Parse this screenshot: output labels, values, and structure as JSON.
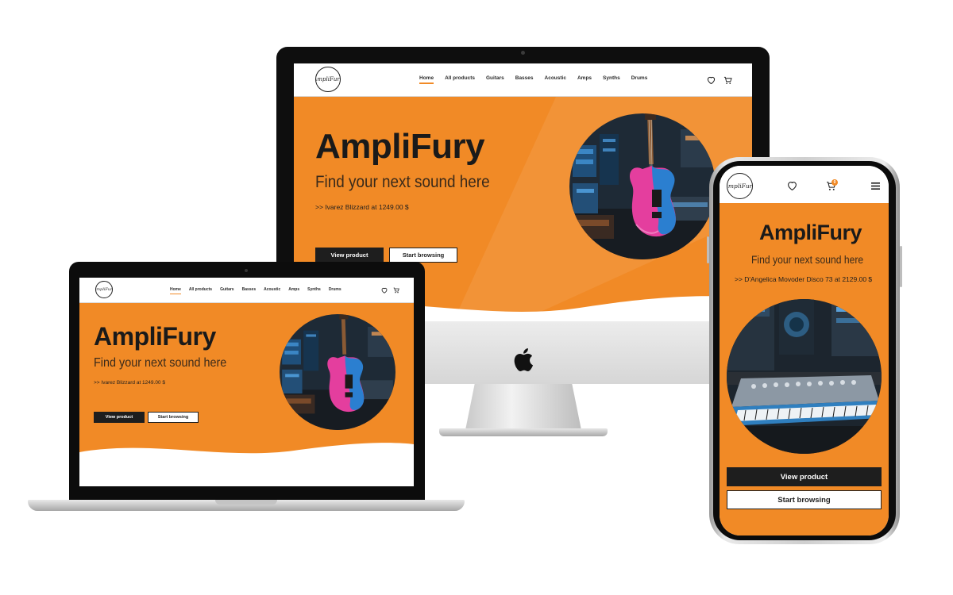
{
  "site": {
    "logo_text": "AmpliFury",
    "nav": [
      "Home",
      "All products",
      "Guitars",
      "Basses",
      "Acoustic",
      "Amps",
      "Synths",
      "Drums"
    ],
    "active_nav": "Home",
    "hero_title": "AmpliFury",
    "hero_subtitle": "Find your next sound here",
    "view_button": "View product",
    "browse_button": "Start browsing"
  },
  "desktop": {
    "promo": ">> Ivarez Blizzard at 1249.00 $",
    "image": "pink-blue-bass-guitar-photo"
  },
  "laptop": {
    "promo": ">> Ivarez Blizzard at 1249.00 $",
    "image": "pink-blue-bass-guitar-photo"
  },
  "mobile": {
    "promo": ">> D'Angelica Movoder Disco 73 at 2129.00 $",
    "image": "vintage-synthesizer-photo",
    "cart_count": "0"
  },
  "icons": {
    "wishlist": "heart-icon",
    "cart": "cart-icon",
    "menu": "hamburger-menu-icon",
    "brand": "apple-logo-icon"
  },
  "colors": {
    "accent": "#f18a26",
    "dark": "#1e1e1e",
    "background": "#ffffff"
  }
}
